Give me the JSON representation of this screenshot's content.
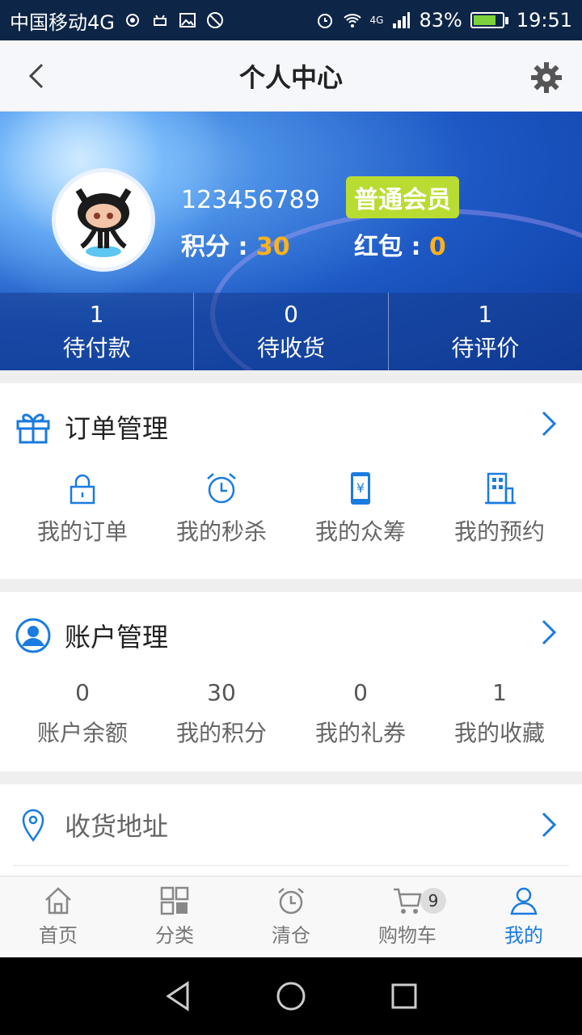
{
  "status_bar": {
    "carrier": "中国移动4G",
    "signal_type": "4G",
    "battery_percent": "83%",
    "battery_level": 0.83,
    "time": "19:51"
  },
  "header": {
    "title": "个人中心",
    "back_icon": "chevron-left-icon",
    "settings_icon": "gear-icon"
  },
  "profile": {
    "user_id": "123456789",
    "member_level": "普通会员",
    "points_label": "积分 : ",
    "points_value": "30",
    "redpacket_label": "红包 : ",
    "redpacket_value": "0",
    "stats": [
      {
        "count": "1",
        "label": "待付款"
      },
      {
        "count": "0",
        "label": "待收货"
      },
      {
        "count": "1",
        "label": "待评价"
      }
    ]
  },
  "orders": {
    "title": "订单管理",
    "icon": "gift-icon",
    "items": [
      {
        "label": "我的订单",
        "icon": "lock-icon"
      },
      {
        "label": "我的秒杀",
        "icon": "alarm-clock-icon"
      },
      {
        "label": "我的众筹",
        "icon": "phone-yen-icon"
      },
      {
        "label": "我的预约",
        "icon": "building-icon"
      }
    ]
  },
  "account": {
    "title": "账户管理",
    "icon": "user-circle-icon",
    "items": [
      {
        "value": "0",
        "label": "账户余额"
      },
      {
        "value": "30",
        "label": "我的积分"
      },
      {
        "value": "0",
        "label": "我的礼券"
      },
      {
        "value": "1",
        "label": "我的收藏"
      }
    ]
  },
  "address": {
    "title": "收货地址",
    "icon": "location-pin-icon"
  },
  "tabbar": {
    "tabs": [
      {
        "label": "首页",
        "icon": "home-icon"
      },
      {
        "label": "分类",
        "icon": "grid-icon"
      },
      {
        "label": "清仓",
        "icon": "alarm-clock-icon"
      },
      {
        "label": "购物车",
        "icon": "cart-icon",
        "badge": "9"
      },
      {
        "label": "我的",
        "icon": "user-icon",
        "active": true
      }
    ]
  },
  "colors": {
    "accent": "#1a7be0",
    "points_highlight": "#ffb21a",
    "member_badge": "#b9dc33"
  }
}
